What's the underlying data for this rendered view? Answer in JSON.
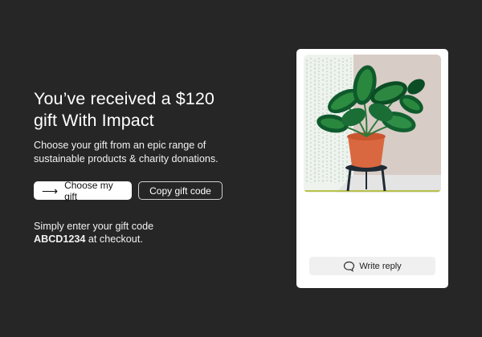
{
  "hero": {
    "title_line1": "You’ve received a $120",
    "title_line2": "gift With Impact",
    "subtitle_line1": "Choose your gift from an epic range of",
    "subtitle_line2": "sustainable products & charity donations."
  },
  "actions": {
    "primary_label": "Choose my gift",
    "secondary_label": "Copy gift code"
  },
  "note": {
    "line1": "Simply enter your gift code",
    "code": "ABCD1234",
    "suffix": " at checkout."
  },
  "card": {
    "image_icon": "potted-plant-illustration",
    "reply_label": "Write reply",
    "reply_icon": "speech-bubble-icon"
  },
  "colors": {
    "background": "#262626",
    "card": "#ffffff",
    "pot": "#d9673f",
    "leaf_dark": "#0f5a2c",
    "leaf_light": "#3fae4e",
    "wall": "#d8ccc6",
    "accent_line": "#b6c24a"
  }
}
